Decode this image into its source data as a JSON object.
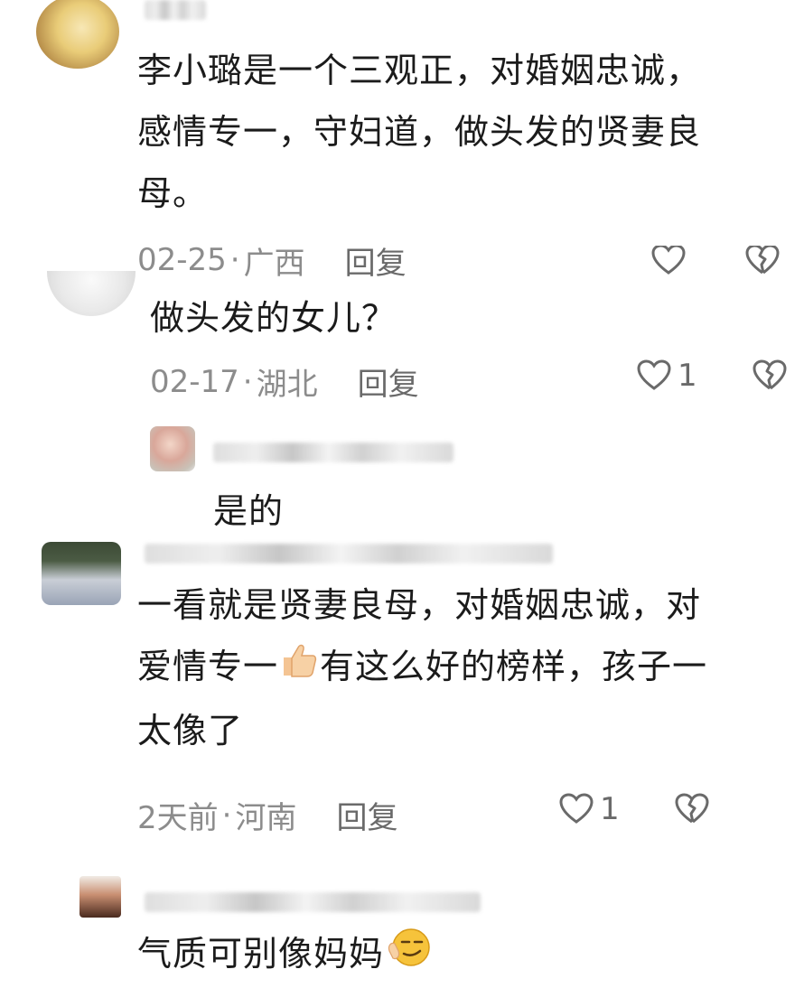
{
  "comments": [
    {
      "text_lines": [
        "李小璐是一个三观正，对婚姻忠诚，",
        "感情专一，守妇道，做头发的贤妻良",
        "母。"
      ],
      "date": "02-25",
      "location": "广西",
      "reply_label": "回复"
    },
    {
      "text_lines": [
        "做头发的女儿？"
      ],
      "date": "02-17",
      "location": "湖北",
      "reply_label": "回复",
      "like_count": "1"
    },
    {
      "text_lines": [
        "是的"
      ]
    },
    {
      "text_lines": [
        "一看就是贤妻良母，对婚姻忠诚，对",
        "爱情专一",
        "有这么好的榜样，孩子一",
        "太像了"
      ],
      "date": "2天前",
      "location": "河南",
      "reply_label": "回复",
      "like_count": "1"
    },
    {
      "text_lines": [
        "气质可别像妈妈"
      ]
    }
  ],
  "meta_separator": "·",
  "icons": {
    "like": "heart-outline-icon",
    "dislike": "broken-heart-icon",
    "thumbs_up": "thumbs-up-emoji",
    "smirk": "smirk-emoji"
  },
  "colors": {
    "text": "#1b1b1b",
    "meta": "#8c8c8c",
    "icon": "#6a6a6a"
  }
}
